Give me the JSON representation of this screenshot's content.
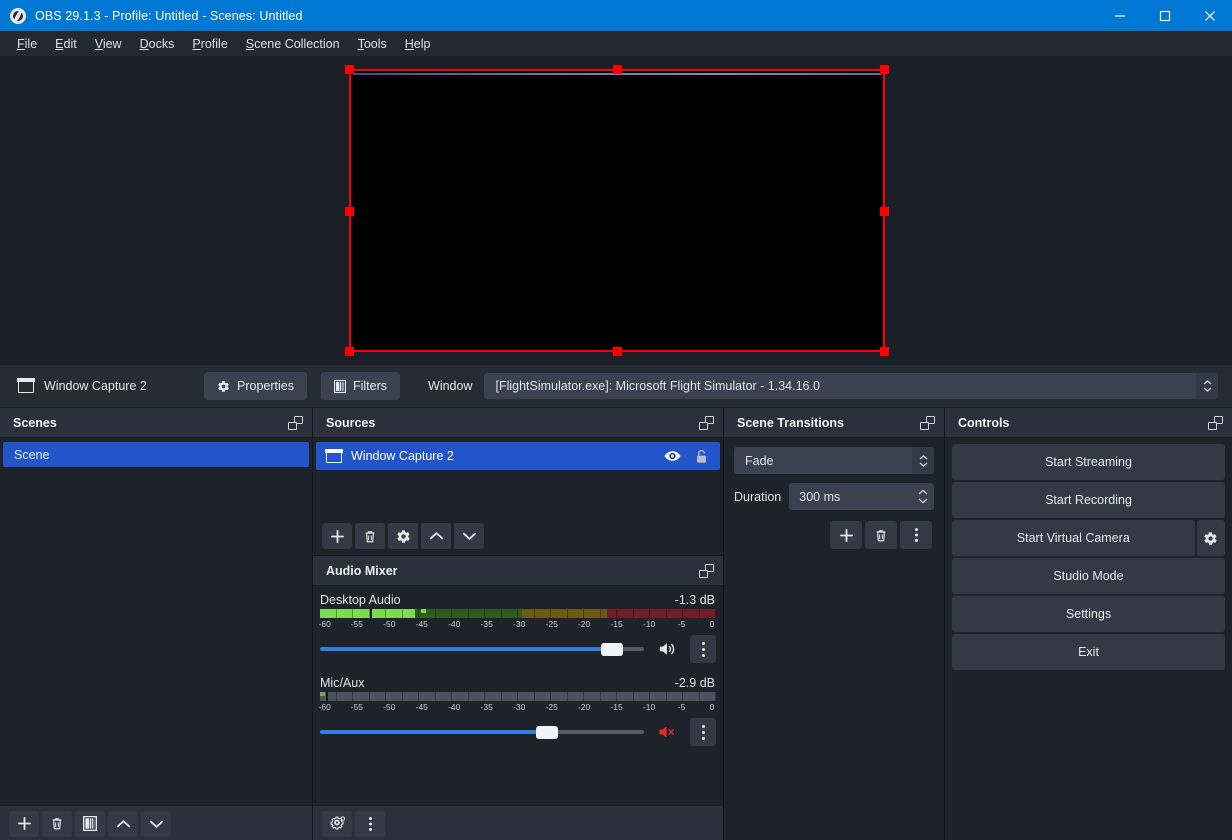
{
  "window": {
    "title": "OBS 29.1.3 - Profile: Untitled - Scenes: Untitled",
    "app_icon": "obs-logo-icon",
    "minimize": "minimize-icon",
    "maximize": "maximize-icon",
    "close": "close-icon"
  },
  "menubar": {
    "items": [
      {
        "label": "File",
        "mnemonic": "F"
      },
      {
        "label": "Edit",
        "mnemonic": "E"
      },
      {
        "label": "View",
        "mnemonic": "V"
      },
      {
        "label": "Docks",
        "mnemonic": "D"
      },
      {
        "label": "Profile",
        "mnemonic": "P"
      },
      {
        "label": "Scene Collection",
        "mnemonic": "S"
      },
      {
        "label": "Tools",
        "mnemonic": "T"
      },
      {
        "label": "Help",
        "mnemonic": "H"
      }
    ]
  },
  "preview": {
    "selection_color": "#ff0000",
    "canvas_background": "#000000"
  },
  "source_toolbar": {
    "source_name": "Window Capture 2",
    "properties_label": "Properties",
    "filters_label": "Filters",
    "window_label": "Window",
    "window_value": "[FlightSimulator.exe]: Microsoft Flight Simulator - 1.34.16.0"
  },
  "scenes": {
    "title": "Scenes",
    "items": [
      {
        "label": "Scene",
        "selected": true
      }
    ],
    "toolbar": [
      {
        "name": "add-scene-button",
        "icon": "plus-icon"
      },
      {
        "name": "remove-scene-button",
        "icon": "trash-icon"
      },
      {
        "name": "scene-filters-button",
        "icon": "filter-icon"
      },
      {
        "name": "move-scene-up-button",
        "icon": "chevron-up-icon"
      },
      {
        "name": "move-scene-down-button",
        "icon": "chevron-down-icon"
      }
    ]
  },
  "sources": {
    "title": "Sources",
    "items": [
      {
        "label": "Window Capture 2",
        "selected": true,
        "visible": true,
        "locked": false
      }
    ],
    "toolbar": [
      {
        "name": "add-source-button",
        "icon": "plus-icon"
      },
      {
        "name": "remove-source-button",
        "icon": "trash-icon"
      },
      {
        "name": "source-properties-button",
        "icon": "gear-icon"
      },
      {
        "name": "move-source-up-button",
        "icon": "chevron-up-icon"
      },
      {
        "name": "move-source-down-button",
        "icon": "chevron-down-icon"
      }
    ]
  },
  "audio_mixer": {
    "title": "Audio Mixer",
    "scale_labels": [
      "-60",
      "-55",
      "-50",
      "-45",
      "-40",
      "-35",
      "-30",
      "-25",
      "-20",
      "-15",
      "-10",
      "-5",
      "0"
    ],
    "tracks": [
      {
        "name": "Desktop Audio",
        "level": "-1.3 dB",
        "meter_percent": 24,
        "peak_percent": 18,
        "volume_percent": 90,
        "muted": false,
        "mute_icon": "speaker-on-icon",
        "menu_icon": "vertical-dots-icon"
      },
      {
        "name": "Mic/Aux",
        "level": "-2.9 dB",
        "meter_percent": 1,
        "peak_percent": 0,
        "volume_percent": 70,
        "muted": true,
        "mute_icon": "speaker-muted-icon",
        "menu_icon": "vertical-dots-icon"
      }
    ],
    "toolbar": [
      {
        "name": "advanced-audio-properties-button",
        "icon": "gears-icon"
      },
      {
        "name": "audio-mixer-menu-button",
        "icon": "vertical-dots-icon"
      }
    ]
  },
  "scene_transitions": {
    "title": "Scene Transitions",
    "transition": "Fade",
    "duration_label": "Duration",
    "duration_value": "300 ms",
    "toolbar": [
      {
        "name": "add-transition-button",
        "icon": "plus-icon"
      },
      {
        "name": "remove-transition-button",
        "icon": "trash-icon"
      },
      {
        "name": "transition-menu-button",
        "icon": "vertical-dots-icon"
      }
    ]
  },
  "controls": {
    "title": "Controls",
    "buttons": [
      {
        "label": "Start Streaming",
        "name": "start-streaming-button"
      },
      {
        "label": "Start Recording",
        "name": "start-recording-button"
      },
      {
        "label": "Start Virtual Camera",
        "name": "start-virtual-camera-button"
      },
      {
        "label": "Studio Mode",
        "name": "studio-mode-button"
      },
      {
        "label": "Settings",
        "name": "settings-button"
      },
      {
        "label": "Exit",
        "name": "exit-button"
      }
    ],
    "virtual_camera_config_icon": "gear-icon"
  },
  "theme": {
    "accent": "#2255c9",
    "titlebar": "#0078d4",
    "panel_bg": "#1e222a",
    "header_bg": "#2b313b",
    "button_bg": "#333a46"
  }
}
